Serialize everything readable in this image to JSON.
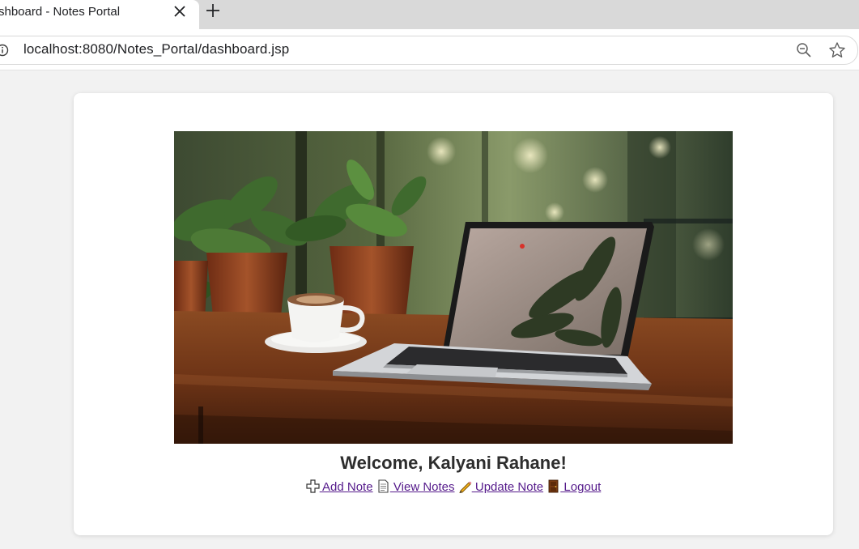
{
  "browser": {
    "tab_title": "shboard - Notes Portal",
    "url": "localhost:8080/Notes_Portal/dashboard.jsp"
  },
  "page": {
    "welcome": "Welcome, Kalyani Rahane!",
    "hero_icon": "laptop-on-wooden-table-photo",
    "nav": [
      {
        "icon": "plus-icon",
        "label": " Add Note"
      },
      {
        "icon": "document-icon",
        "label": " View Notes"
      },
      {
        "icon": "pencil-icon",
        "label": " Update Note"
      },
      {
        "icon": "door-icon",
        "label": " Logout"
      }
    ]
  }
}
